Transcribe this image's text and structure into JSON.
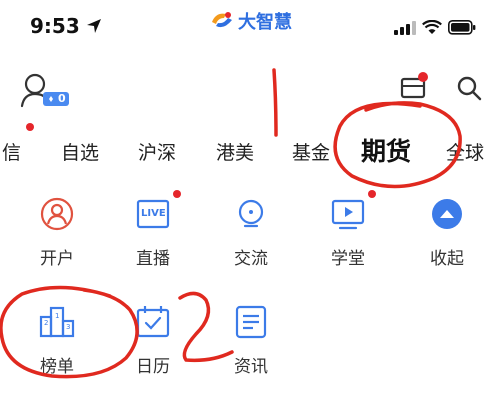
{
  "status_bar": {
    "time": "9:53",
    "location_icon": "location-arrow-icon",
    "signal_icon": "cellular-signal-icon",
    "wifi_icon": "wifi-icon",
    "battery_icon": "battery-icon"
  },
  "app": {
    "brand_name": "大智慧",
    "logo_icon": "dazhihui-logo-icon"
  },
  "header": {
    "avatar_badge": "0",
    "message_icon": "message-box-icon",
    "search_icon": "search-icon"
  },
  "tabs": [
    {
      "label": "信",
      "has_dot": true
    },
    {
      "label": "自选"
    },
    {
      "label": "沪深"
    },
    {
      "label": "港美"
    },
    {
      "label": "基金"
    },
    {
      "label": "期货",
      "active": true
    },
    {
      "label": "全球"
    }
  ],
  "features": [
    {
      "label": "开户",
      "icon": "open-account-icon"
    },
    {
      "label": "直播",
      "icon": "live-icon",
      "badge_text": "LIVE",
      "has_dot": true
    },
    {
      "label": "交流",
      "icon": "chat-icon"
    },
    {
      "label": "学堂",
      "icon": "classroom-icon",
      "has_dot": true
    },
    {
      "label": "收起",
      "icon": "collapse-icon"
    },
    {
      "label": "榜单",
      "icon": "ranking-podium-icon"
    },
    {
      "label": "日历",
      "icon": "calendar-icon"
    },
    {
      "label": "资讯",
      "icon": "news-icon"
    }
  ],
  "annotations": {
    "mark_1": "1",
    "mark_2": "2",
    "color": "#e0291f"
  },
  "colors": {
    "accent_red": "#e5262b",
    "icon_blue": "#3c7be8",
    "icon_red": "#e0523f"
  }
}
